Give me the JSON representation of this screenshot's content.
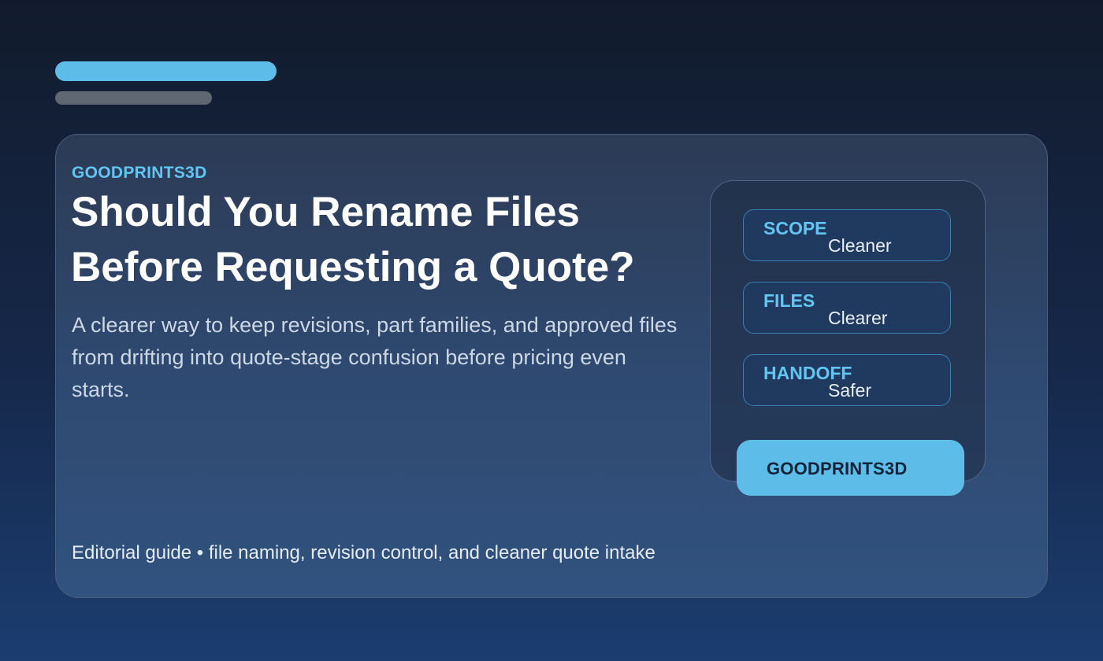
{
  "card": {
    "brand": "GOODPRINTS3D",
    "title": "Should You Rename Files Before Requesting a Quote?",
    "subtitle": "A clearer way to keep revisions, part families, and approved files from drifting into quote-stage confusion before pricing even starts.",
    "footer": "Editorial guide • file naming, revision control, and cleaner quote intake"
  },
  "panel": {
    "rows": [
      {
        "label": "SCOPE",
        "value": "Cleaner"
      },
      {
        "label": "FILES",
        "value": "Clearer"
      },
      {
        "label": "HANDOFF",
        "value": "Safer"
      }
    ],
    "button_label": "GOODPRINTS3D"
  },
  "colors": {
    "accent": "#5ebde8",
    "label_blue": "#63c6f2",
    "background_top": "#111b2c",
    "background_bottom": "#1b3d70",
    "card": "#2f4a72",
    "placeholder_bar": "#5f6773"
  }
}
